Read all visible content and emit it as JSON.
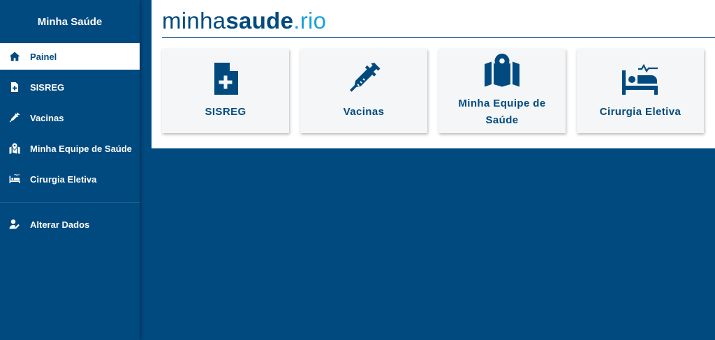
{
  "sidebar": {
    "title": "Minha Saúde",
    "items": [
      {
        "label": "Painel",
        "icon": "home-icon"
      },
      {
        "label": "SISREG",
        "icon": "file-plus-icon"
      },
      {
        "label": "Vacinas",
        "icon": "syringe-icon"
      },
      {
        "label": "Minha Equipe de Saúde",
        "icon": "map-pin-icon"
      },
      {
        "label": "Cirurgia Eletiva",
        "icon": "hospital-bed-icon"
      }
    ],
    "secondary": [
      {
        "label": "Alterar Dados",
        "icon": "user-edit-icon"
      }
    ]
  },
  "header": {
    "logo_part1": "minha",
    "logo_part2": "saude",
    "logo_part3": ".rio"
  },
  "cards": [
    {
      "label": "SISREG",
      "icon": "file-plus-icon"
    },
    {
      "label": "Vacinas",
      "icon": "syringe-icon"
    },
    {
      "label": "Minha Equipe de Saúde",
      "icon": "map-pin-icon"
    },
    {
      "label": "Cirurgia Eletiva",
      "icon": "hospital-bed-icon"
    }
  ],
  "colors": {
    "primary": "#004a80",
    "accent": "#1aa0db",
    "card_bg": "#f5f6f8"
  }
}
